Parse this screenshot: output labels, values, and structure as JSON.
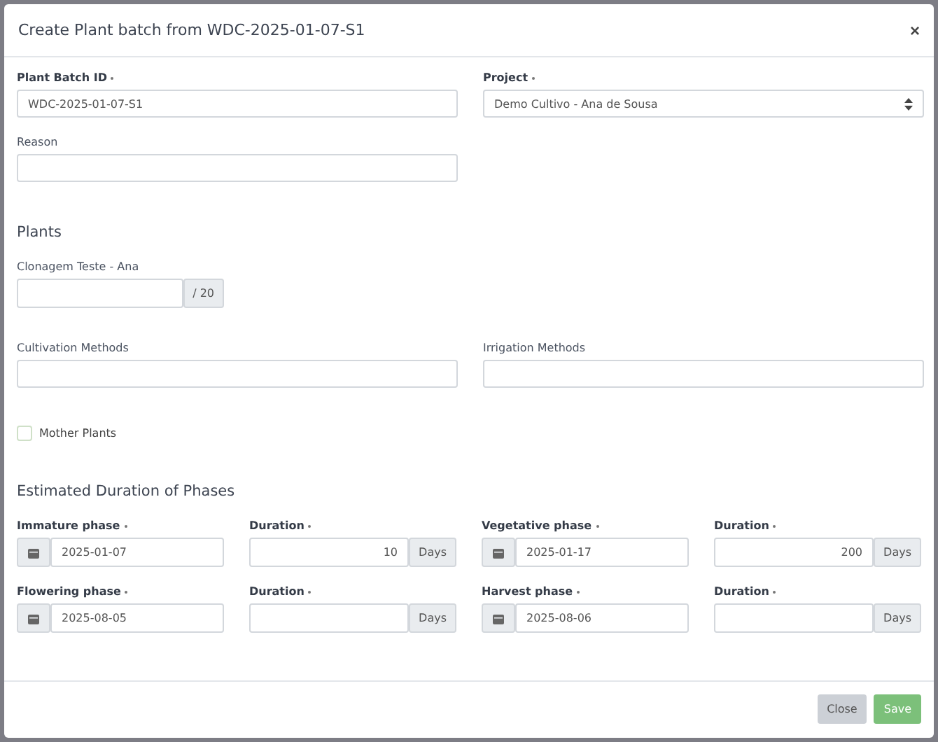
{
  "dialog": {
    "title": "Create Plant batch from WDC-2025-01-07-S1",
    "close": "×"
  },
  "fields": [
    {
      "label": "Plant Batch ID",
      "required": true,
      "kind": "text",
      "value": "WDC-2025-01-07-S1"
    },
    {
      "label": "Project",
      "required": true,
      "kind": "select",
      "value": "Demo Cultivo - Ana de Sousa"
    },
    {
      "label": "Reason",
      "required": false,
      "kind": "text"
    }
  ],
  "plants": {
    "heading": "Plants",
    "label": "Clonagem Teste - Ana",
    "suffix": "/ 20"
  },
  "methods": [
    {
      "label": "Cultivation Methods"
    },
    {
      "label": "Irrigation Methods"
    }
  ],
  "mother_plants": {
    "label": "Mother Plants",
    "checked": false
  },
  "phases": {
    "heading": "Estimated Duration of Phases",
    "items": [
      {
        "label": "Immature phase",
        "date": "2025-01-07",
        "duration_label": "Duration",
        "duration": "10",
        "unit": "Days"
      },
      {
        "label": "Vegetative phase",
        "date": "2025-01-17",
        "duration_label": "Duration",
        "duration": "200",
        "unit": "Days"
      },
      {
        "label": "Flowering phase",
        "date": "2025-08-05",
        "duration_label": "Duration",
        "unit": "Days"
      },
      {
        "label": "Harvest phase",
        "date": "2025-08-06",
        "duration_label": "Duration",
        "unit": "Days"
      }
    ]
  },
  "buttons": [
    {
      "label": "Close",
      "kind": "secondary"
    },
    {
      "label": "Save",
      "kind": "primary"
    }
  ]
}
